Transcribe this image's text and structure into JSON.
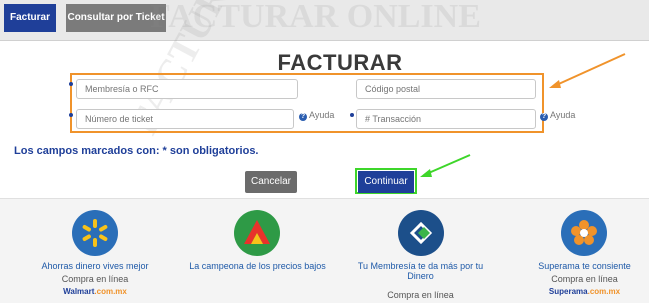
{
  "tabs": [
    {
      "label": "Facturar",
      "active": true
    },
    {
      "label": "Consultar por Ticket",
      "active": false
    }
  ],
  "watermark": {
    "text": "FACTURAR ONLINE"
  },
  "form": {
    "title": "FACTURAR",
    "fields": {
      "membership": {
        "placeholder": "Membresía o RFC"
      },
      "postal": {
        "placeholder": "Código postal"
      },
      "ticket": {
        "placeholder": "Número de ticket"
      },
      "transaction": {
        "placeholder": "# Transacción"
      }
    },
    "help_label": "Ayuda",
    "required_note": "Los campos marcados con: * son obligatorios."
  },
  "buttons": {
    "cancel": "Cancelar",
    "continue": "Continuar"
  },
  "brands": [
    {
      "title": "Ahorras dinero vives mejor",
      "sub": "Compra en línea",
      "link_a": "Walmart",
      "link_b": ".com.mx",
      "color": "#2a6eb8",
      "icon": "walmart-spark-icon"
    },
    {
      "title": "La campeona de los precios bajos",
      "sub": "",
      "link_a": "",
      "link_b": "",
      "color": "#2e9a46",
      "icon": "bodega-aurrera-icon"
    },
    {
      "title": "Tu Membresía te da más por tu Dinero",
      "sub": "Compra en línea",
      "link_a": "",
      "link_b": "",
      "color": "#1c4f8a",
      "icon": "sams-club-icon"
    },
    {
      "title": "Superama te consiente",
      "sub": "Compra en línea",
      "link_a": "Superama",
      "link_b": ".com.mx",
      "color": "#2a6eb8",
      "icon": "superama-flower-icon"
    }
  ],
  "colors": {
    "primary": "#1f3f99",
    "accent_orange": "#f0932b",
    "accent_green": "#3ed62a"
  }
}
